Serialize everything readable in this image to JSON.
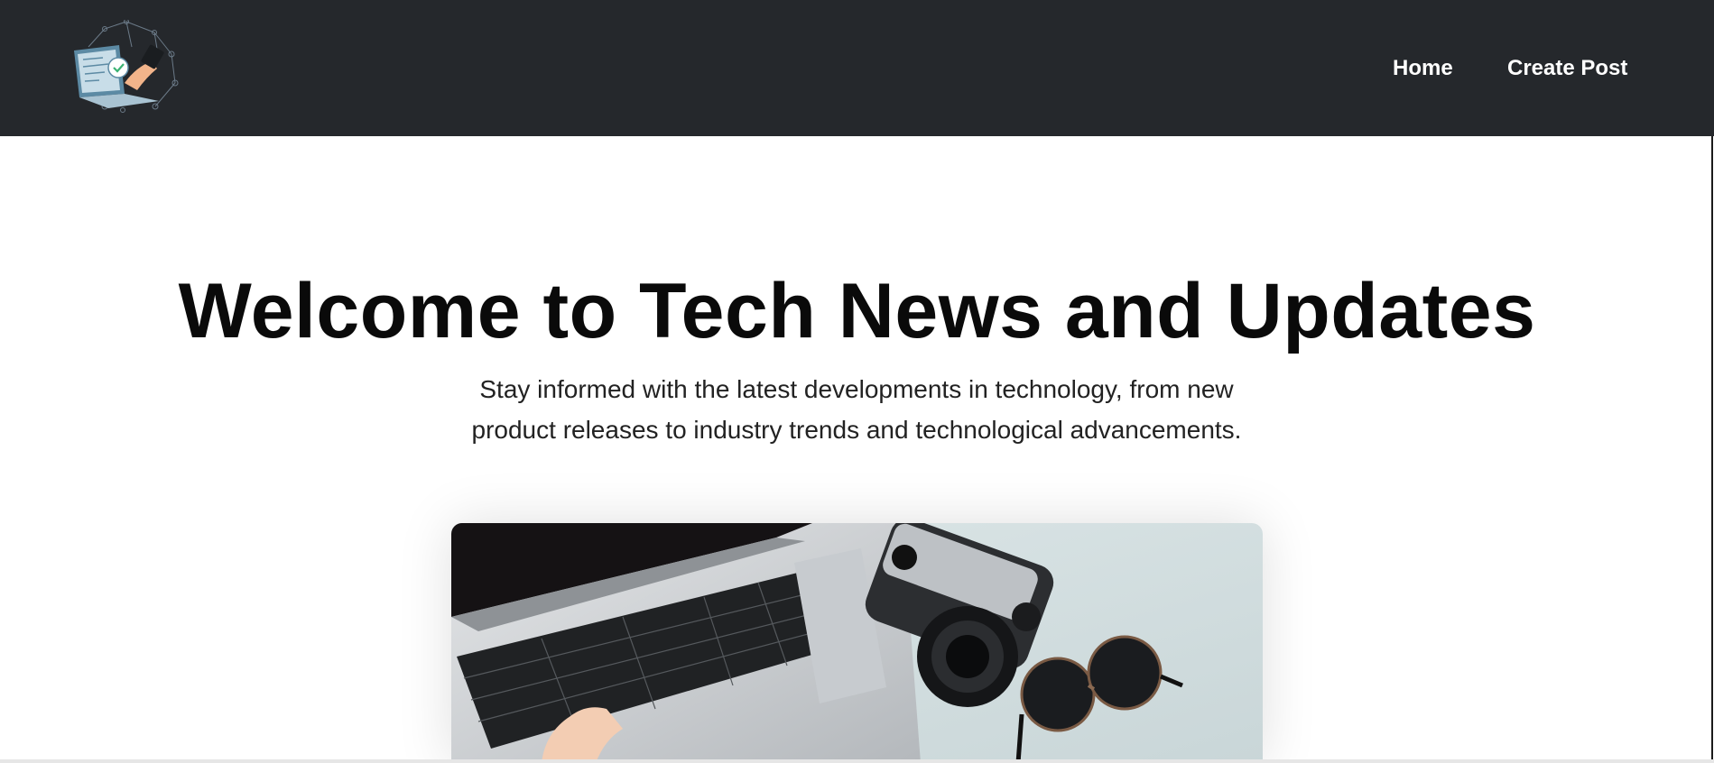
{
  "header": {
    "logo_name": "tech-laptop-logo",
    "nav": [
      {
        "label": "Home"
      },
      {
        "label": "Create Post"
      }
    ],
    "bg_color": "#25282c"
  },
  "hero": {
    "title": "Welcome to Tech News and Updates",
    "subtitle": "Stay informed with the latest developments in technology, from new product releases to industry trends and technological advancements.",
    "image_name": "laptop-camera-sunglasses-photo"
  }
}
